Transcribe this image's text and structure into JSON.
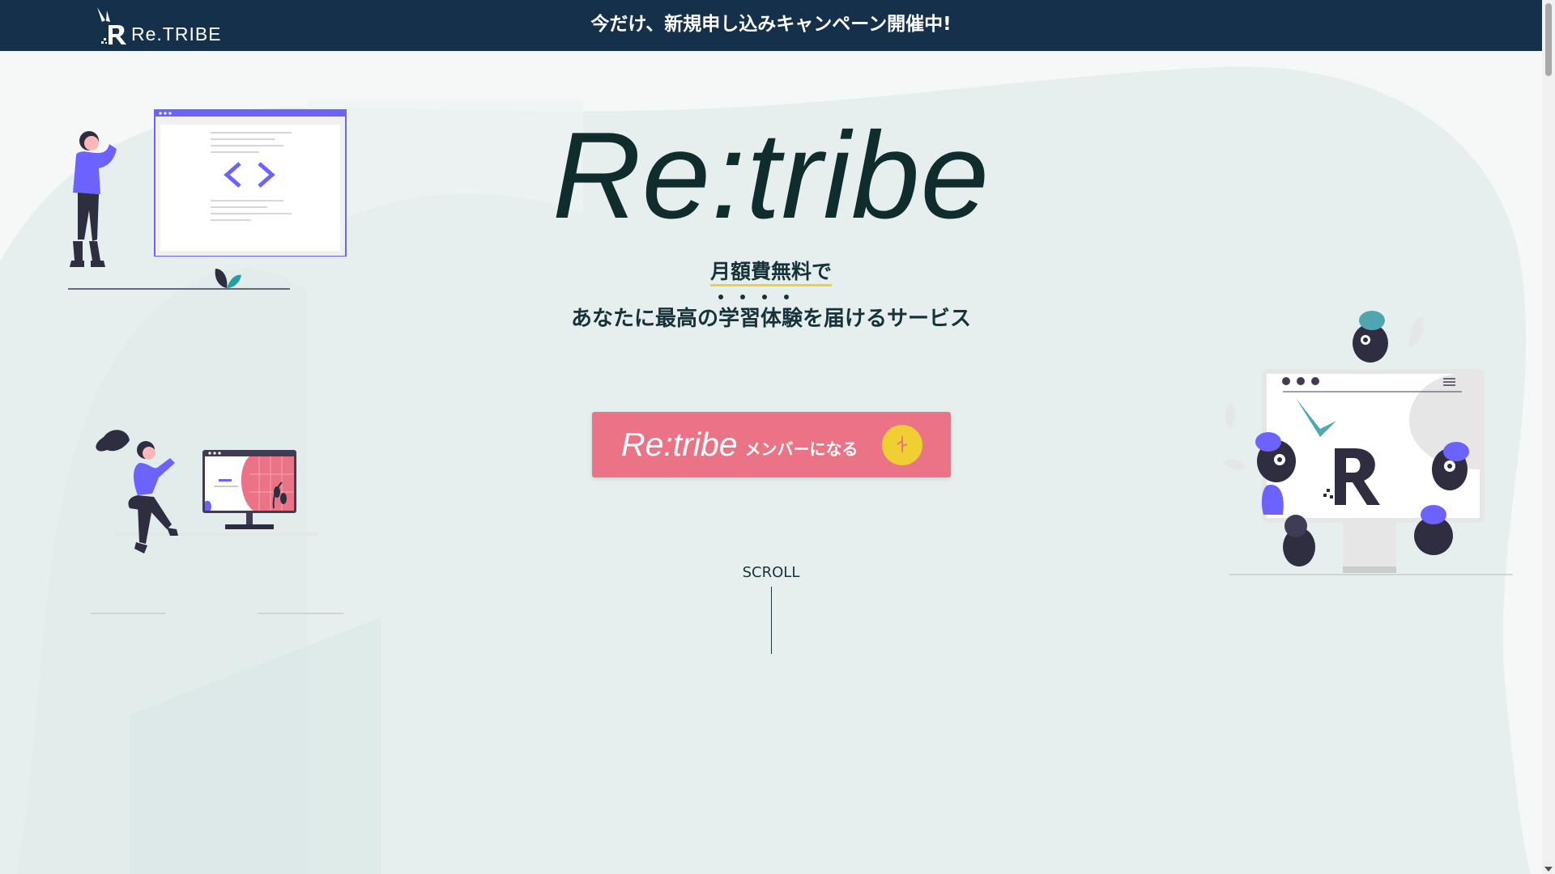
{
  "header": {
    "logo_text": "Re.TRIBE",
    "announcement": "今だけ、新規申し込みキャンペーン開催中!"
  },
  "hero": {
    "title": "Re:tribe",
    "tagline_line1": "月額費無料で",
    "tagline_line2": "あなたに最高の学習体験を届けるサービス",
    "cta_brand": "Re:tribe",
    "cta_label": "メンバーになる",
    "scroll_label": "SCROLL"
  },
  "colors": {
    "header_bg": "#15304a",
    "cta_bg": "#ea7386",
    "cta_icon_bg": "#efcf31",
    "accent_purple": "#6c63ff",
    "text_dark": "#16323a"
  }
}
